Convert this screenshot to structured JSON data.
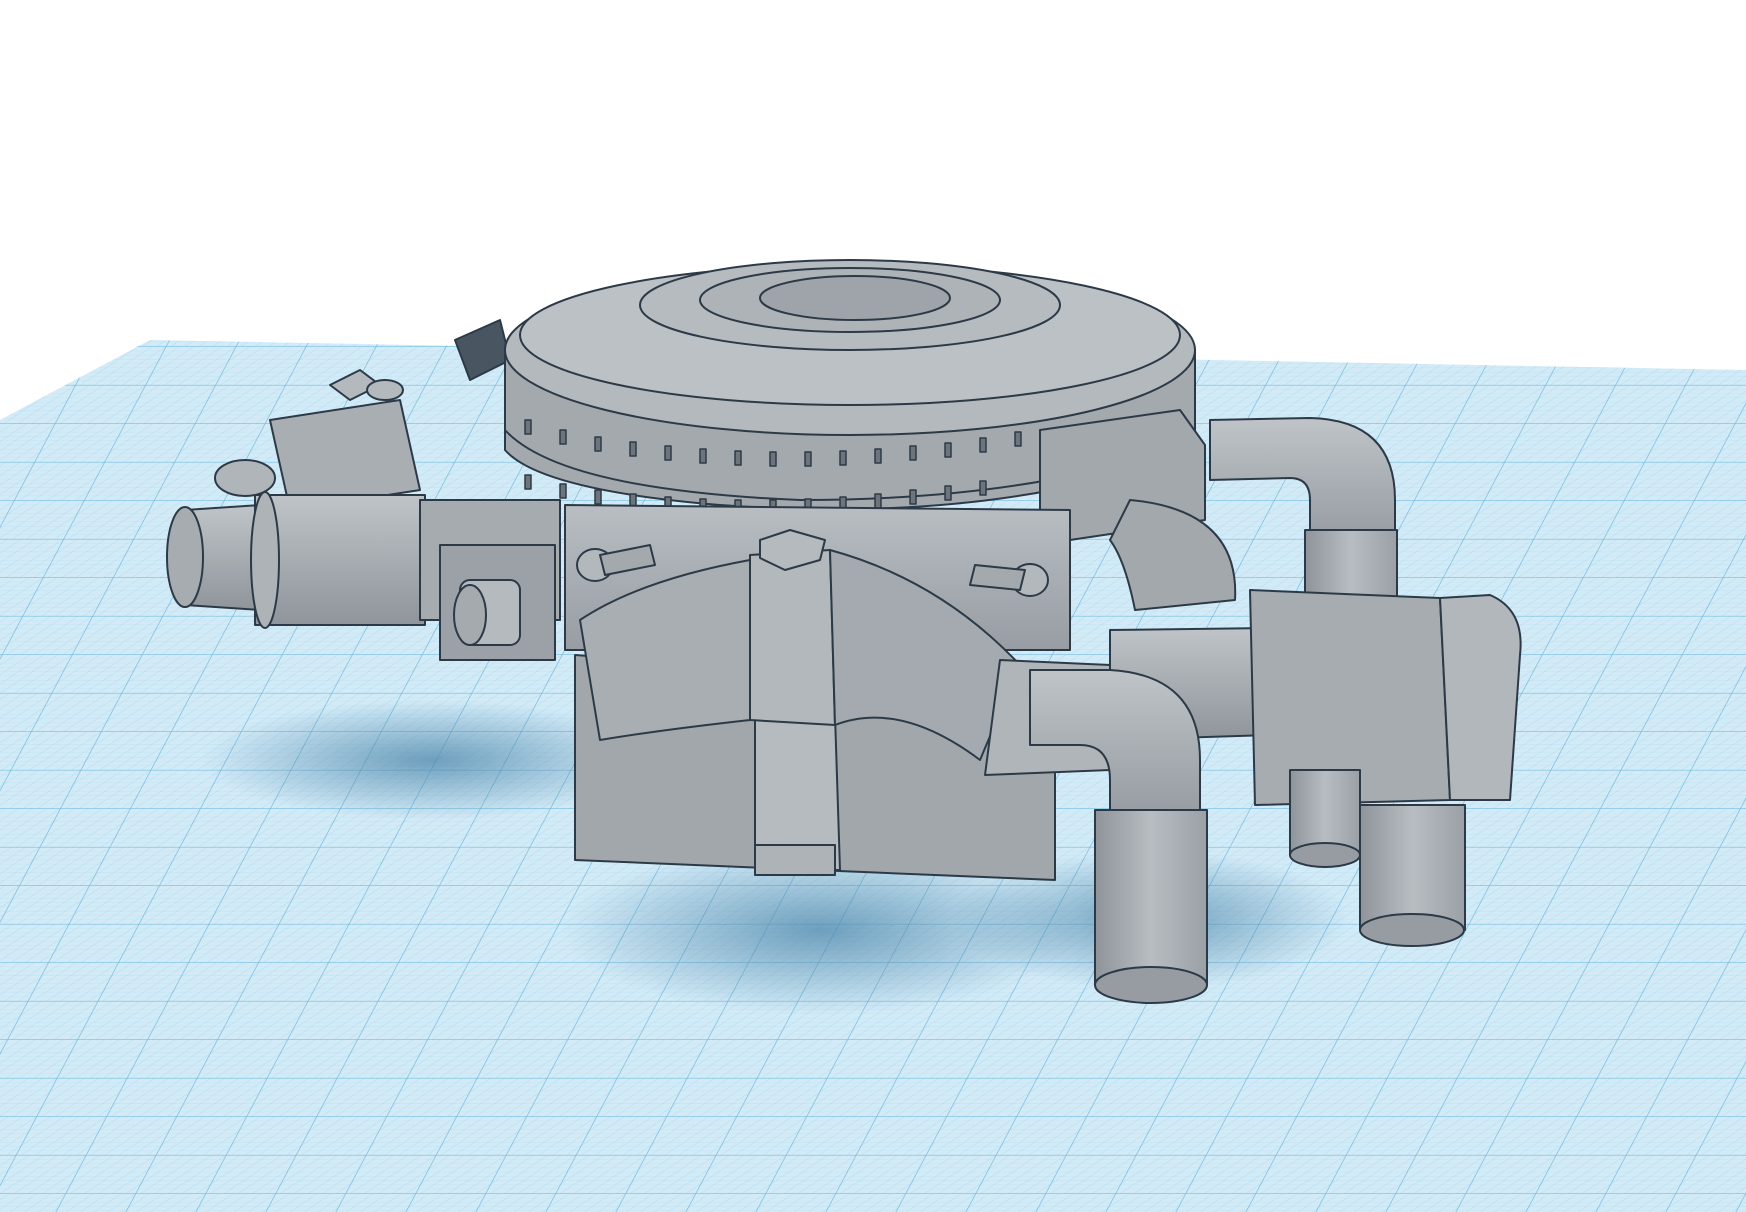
{
  "workplane": {
    "grid_color": "#7fc3e6",
    "grid_fill": "#d9eef8",
    "fade_watermark": ""
  },
  "model": {
    "fill_color": "#a8adb3",
    "edge_color": "#2c3a48",
    "shadow_color": "#5a8fb0"
  },
  "background": {
    "color": "#ffffff"
  }
}
